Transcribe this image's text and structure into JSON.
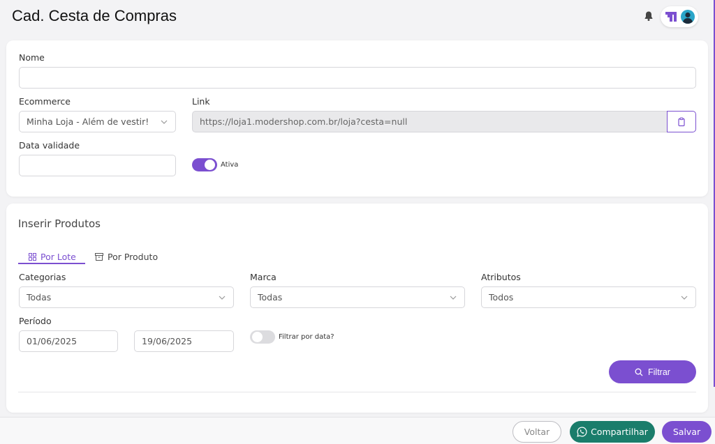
{
  "header": {
    "title": "Cad. Cesta de Compras"
  },
  "form": {
    "nome_label": "Nome",
    "nome_value": "",
    "ecommerce_label": "Ecommerce",
    "ecommerce_value": "Minha Loja - Além de vestir!",
    "link_label": "Link",
    "link_value": "https://loja1.modershop.com.br/loja?cesta=null",
    "data_validade_label": "Data validade",
    "data_validade_value": "",
    "ativa_label": "Ativa",
    "ativa_on": true
  },
  "products": {
    "section_title": "Inserir Produtos",
    "tabs": [
      {
        "label": "Por Lote",
        "active": true,
        "icon": "grid-icon"
      },
      {
        "label": "Por Produto",
        "active": false,
        "icon": "archive-icon"
      }
    ],
    "categorias_label": "Categorias",
    "categorias_value": "Todas",
    "marca_label": "Marca",
    "marca_value": "Todas",
    "atributos_label": "Atributos",
    "atributos_value": "Todos",
    "periodo_label": "Período",
    "periodo_start": "01/06/2025",
    "periodo_end": "19/06/2025",
    "filtrar_data_label": "Filtrar por data?",
    "filtrar_data_on": false,
    "filtrar_button": "Filtrar"
  },
  "footer": {
    "voltar": "Voltar",
    "compartilhar": "Compartilhar",
    "salvar": "Salvar"
  },
  "colors": {
    "accent": "#7b4fd0",
    "share": "#1a7d6b"
  }
}
